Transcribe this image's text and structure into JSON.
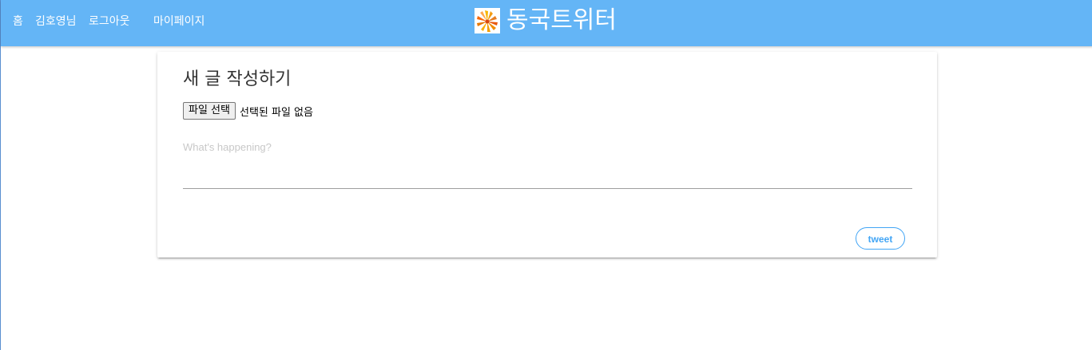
{
  "nav": {
    "home": "홈",
    "user": "김호영님",
    "logout": "로그아웃",
    "mypage": "마이페이지"
  },
  "brand": {
    "title": "동국트위터",
    "logo_icon": "flower-logo-icon"
  },
  "composer": {
    "title": "새 글 작성하기",
    "file_button": "파일 선택",
    "file_status": "선택된 파일 없음",
    "placeholder": "What's happening?",
    "submit_label": "tweet"
  },
  "colors": {
    "navbar": "#64b5f6",
    "accent": "#42a5f5"
  }
}
